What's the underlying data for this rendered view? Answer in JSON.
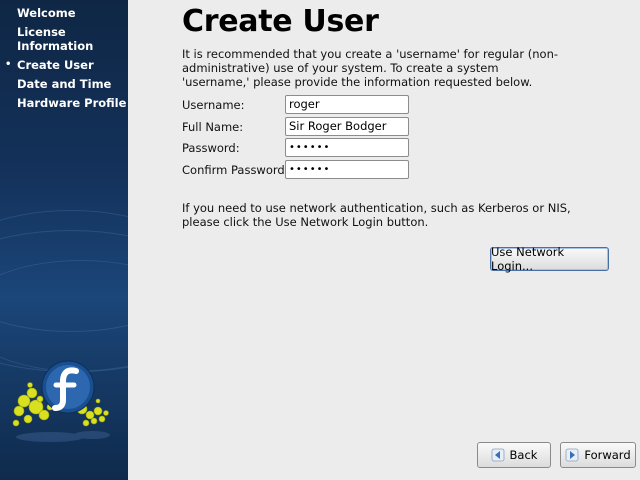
{
  "sidebar": {
    "items": [
      {
        "label": "Welcome",
        "current": false
      },
      {
        "label": "License\nInformation",
        "current": false
      },
      {
        "label": "Create User",
        "current": true
      },
      {
        "label": "Date and Time",
        "current": false
      },
      {
        "label": "Hardware Profile",
        "current": false
      }
    ],
    "current_marker": "•"
  },
  "main": {
    "title": "Create User",
    "intro": "It is recommended that you create a 'username' for regular (non-administrative) use of your system. To create a system 'username,' please provide the information requested below.",
    "form": {
      "username_label": "Username:",
      "username_value": "roger",
      "fullname_label": "Full Name:",
      "fullname_value": "Sir Roger Bodger",
      "password_label": "Password:",
      "password_value": "••••••",
      "confirm_label": "Confirm Password:",
      "confirm_value": "••••••"
    },
    "network_info": "If you need to use network authentication, such as Kerberos or NIS, please click the Use Network Login button.",
    "network_button": "Use Network Login..."
  },
  "nav": {
    "back_label": "Back",
    "forward_label": "Forward"
  },
  "icons": {
    "logo": "fedora-logo-icon",
    "back": "back-arrow-icon",
    "forward": "forward-arrow-icon"
  },
  "colors": {
    "sidebar_dark": "#0f2745",
    "sidebar_light": "#1b4679",
    "accent_yellow": "#d8e020",
    "button_focus": "#4a6fa5"
  }
}
